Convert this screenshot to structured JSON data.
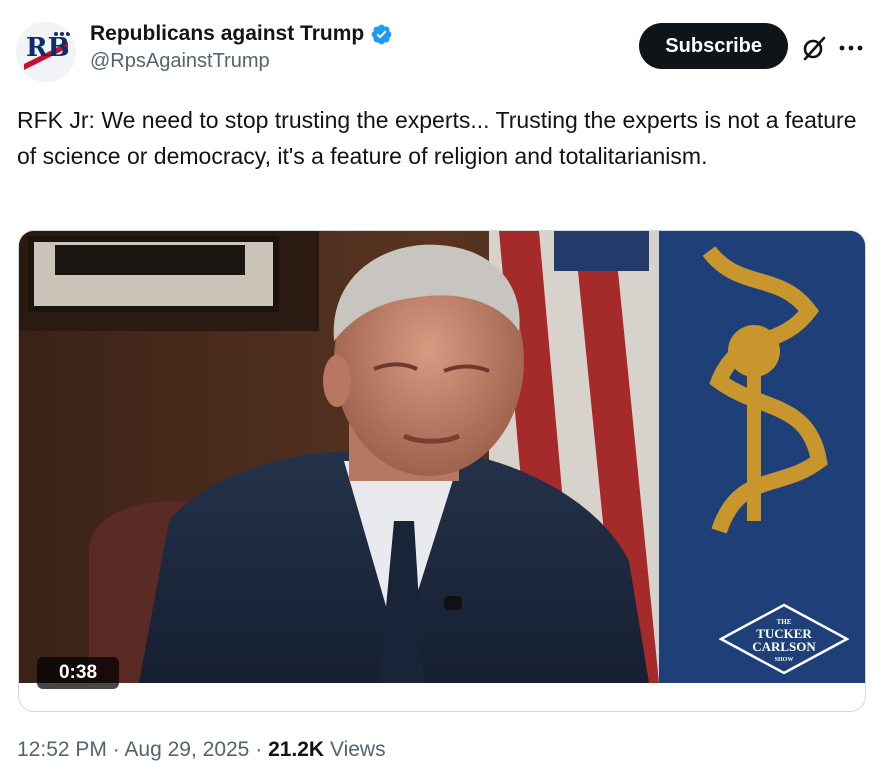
{
  "author": {
    "display_name": "Republicans against Trump",
    "handle": "@RpsAgainstTrump",
    "avatar_initials": "RB",
    "verified": true
  },
  "actions": {
    "subscribe_label": "Subscribe",
    "grok_icon": "grok-icon",
    "more_icon": "more-icon"
  },
  "tweet": {
    "text": "RFK Jr: We need to stop trusting the experts... Trusting the experts is not a feature of science or democracy, it's a feature of religion and totalitarianism."
  },
  "media": {
    "duration": "0:38",
    "watermark": {
      "the": "THE",
      "line1": "TUCKER",
      "line2": "CARLSON",
      "show": "SHOW"
    }
  },
  "meta": {
    "time": "12:52 PM",
    "separator": "·",
    "date": "Aug 29, 2025",
    "views_count": "21.2K",
    "views_label": "Views"
  },
  "colors": {
    "accent": "#1d9bf0",
    "text": "#0f1419",
    "muted": "#536471",
    "button": "#0f1419"
  }
}
